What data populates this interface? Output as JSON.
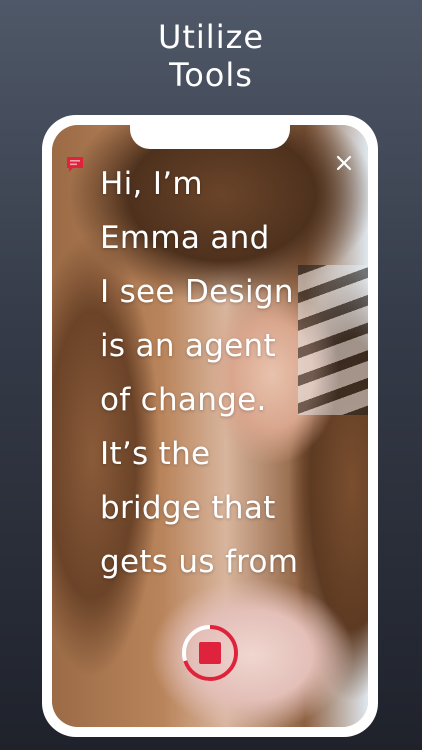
{
  "headline": {
    "lines": [
      "Utilize",
      "Tools"
    ]
  },
  "transcript": {
    "lines": [
      "Hi, I’m",
      "Emma and",
      "I see Design",
      "is an agent",
      "of change.",
      "It’s the",
      "bridge that",
      "gets us from"
    ]
  },
  "icons": {
    "caption": "caption-icon",
    "close": "close-icon",
    "record": "stop-record-icon"
  },
  "recording": {
    "progress": 0.7
  },
  "colors": {
    "accent": "#e0233c",
    "text": "#ffffff",
    "background_top": "#4f5868",
    "background_bottom": "#1f222b"
  }
}
